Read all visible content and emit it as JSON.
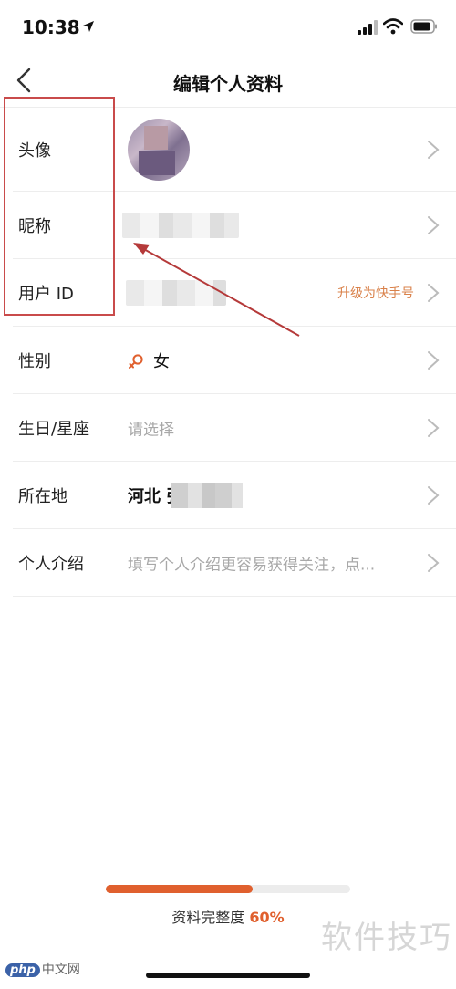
{
  "status_bar": {
    "time": "10:38",
    "icons": [
      "location-arrow-icon",
      "signal-icon",
      "wifi-icon",
      "battery-icon"
    ]
  },
  "nav": {
    "back_icon": "chevron-left-icon",
    "title": "编辑个人资料"
  },
  "rows": {
    "avatar": {
      "label": "头像"
    },
    "nickname": {
      "label": "昵称"
    },
    "user_id": {
      "label": "用户 ID",
      "action": "升级为快手号"
    },
    "gender": {
      "label": "性别",
      "value": "女",
      "icon": "female-icon"
    },
    "birthday": {
      "label": "生日/星座",
      "placeholder": "请选择"
    },
    "location": {
      "label": "所在地",
      "value": "河北 张"
    },
    "bio": {
      "label": "个人介绍",
      "placeholder": "填写个人介绍更容易获得关注，点..."
    }
  },
  "progress": {
    "label": "资料完整度",
    "value_text": "60%",
    "fraction": 0.6
  },
  "watermark": {
    "right": "软件技巧",
    "left_badge": "php",
    "left_text": "中文网"
  },
  "colors": {
    "accent": "#e0602e",
    "link": "#d9814a",
    "highlight": "#c94b4b",
    "divider": "#ededed",
    "placeholder": "#a8a8a8"
  }
}
